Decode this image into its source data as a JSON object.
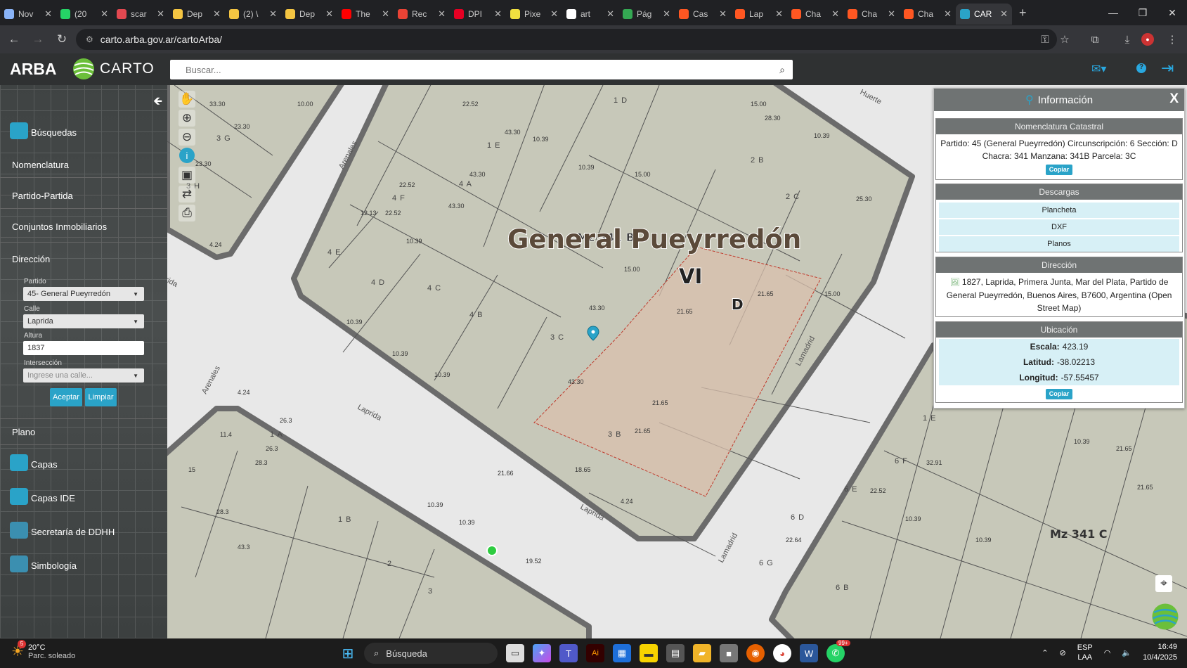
{
  "browser": {
    "tabs": [
      {
        "label": "Nov",
        "icon": "chrome-icon",
        "color": "#8ab4f8"
      },
      {
        "label": "(20",
        "icon": "whatsapp-icon",
        "color": "#25d366"
      },
      {
        "label": "scar",
        "icon": "adobe-icon",
        "color": "#e34850"
      },
      {
        "label": "Dep",
        "icon": "hat-icon",
        "color": "#f4c542"
      },
      {
        "label": "(2) \\",
        "icon": "hat-icon",
        "color": "#f4c542"
      },
      {
        "label": "Dep",
        "icon": "hat-icon",
        "color": "#f4c542"
      },
      {
        "label": "The",
        "icon": "youtube-icon",
        "color": "#ff0000"
      },
      {
        "label": "Rec",
        "icon": "gmail-icon",
        "color": "#ea4335"
      },
      {
        "label": "DPI",
        "icon": "pinterest-icon",
        "color": "#e60023"
      },
      {
        "label": "Pixe",
        "icon": "pixel-icon",
        "color": "#f0e040"
      },
      {
        "label": "art",
        "icon": "google-icon",
        "color": "#ffffff"
      },
      {
        "label": "Pág",
        "icon": "drive-icon",
        "color": "#34a853"
      },
      {
        "label": "Cas",
        "icon": "question-icon",
        "color": "#ff5722"
      },
      {
        "label": "Lap",
        "icon": "question-icon",
        "color": "#ff5722"
      },
      {
        "label": "Cha",
        "icon": "question-icon",
        "color": "#ff5722"
      },
      {
        "label": "Cha",
        "icon": "question-icon",
        "color": "#ff5722"
      },
      {
        "label": "Cha",
        "icon": "question-icon",
        "color": "#ff5722"
      },
      {
        "label": "CAR",
        "icon": "carto-icon",
        "color": "#2aa3c8",
        "active": true
      }
    ],
    "url": "carto.arba.gov.ar/cartoArba/"
  },
  "header": {
    "brand": "ARBA",
    "logo_text": "CARTO",
    "search_placeholder": "Buscar..."
  },
  "sidebar": {
    "items": {
      "busquedas": "Búsquedas",
      "nomenclatura": "Nomenclatura",
      "partido_partida": "Partido-Partida",
      "conjuntos": "Conjuntos Inmobiliarios",
      "direccion": "Dirección",
      "plano": "Plano",
      "capas": "Capas",
      "capas_ide": "Capas IDE",
      "secretaria": "Secretaría de DDHH",
      "simbologia": "Simbología"
    },
    "form": {
      "partido_label": "Partido",
      "partido_value": "45- General Pueyrredón",
      "calle_label": "Calle",
      "calle_value": "Laprida",
      "altura_label": "Altura",
      "altura_value": "1837",
      "interseccion_label": "Intersección",
      "interseccion_placeholder": "Ingrese una calle...",
      "aceptar": "Aceptar",
      "limpiar": "Limpiar"
    }
  },
  "map": {
    "title": "General Pueyrredón",
    "subtitle_vi": "VI",
    "subtitle_d": "D",
    "mz_341b": "Mz 341 B",
    "mz_341c": "Mz 341 C",
    "streets": {
      "arenales1": "Arenales",
      "arenales2": "Arenales",
      "laprida1": "Laprida",
      "laprida2": "Laprida",
      "laprida3": "Laprida",
      "lamadrid1": "Lamadrid",
      "lamadrid2": "Lamadrid",
      "huerte": "Huerte"
    },
    "parcels": [
      "1 D",
      "1 E",
      "2 B",
      "2 C",
      "3 C",
      "3 B",
      "4 A",
      "4 F",
      "4 E",
      "4 D",
      "4 C",
      "4 B",
      "3 G",
      "3 H",
      "1 A",
      "1 B",
      "2",
      "3",
      "6 F",
      "6 E",
      "6 D",
      "6 G",
      "6 B",
      "1 E"
    ],
    "selected_parcel": "3 C"
  },
  "info": {
    "title": "Información",
    "close": "X",
    "nomenclatura_title": "Nomenclatura Catastral",
    "nomenclatura_text": "Partido: 45 (General Pueyrredón) Circunscripción: 6 Sección: D Chacra: 341 Manzana: 341B Parcela: 3C",
    "copiar": "Copiar",
    "descargas_title": "Descargas",
    "descargas": [
      "Plancheta",
      "DXF",
      "Planos"
    ],
    "direccion_title": "Dirección",
    "direccion_text": "1827, Laprida, Primera Junta, Mar del Plata, Partido de General Pueyrredón, Buenos Aires, B7600, Argentina (Open Street Map)",
    "ubicacion_title": "Ubicación",
    "escala_label": "Escala:",
    "escala_value": "423.19",
    "latitud_label": "Latitud:",
    "latitud_value": "-38.02213",
    "longitud_label": "Longitud:",
    "longitud_value": "-57.55457",
    "copiar2": "Copiar"
  },
  "taskbar": {
    "temp": "20°C",
    "weather": "Parc. soleado",
    "search": "Búsqueda",
    "lang1": "ESP",
    "lang2": "LAA",
    "time": "16:49",
    "date": "10/4/2025",
    "badge": "99+",
    "weather_badge": "5"
  }
}
